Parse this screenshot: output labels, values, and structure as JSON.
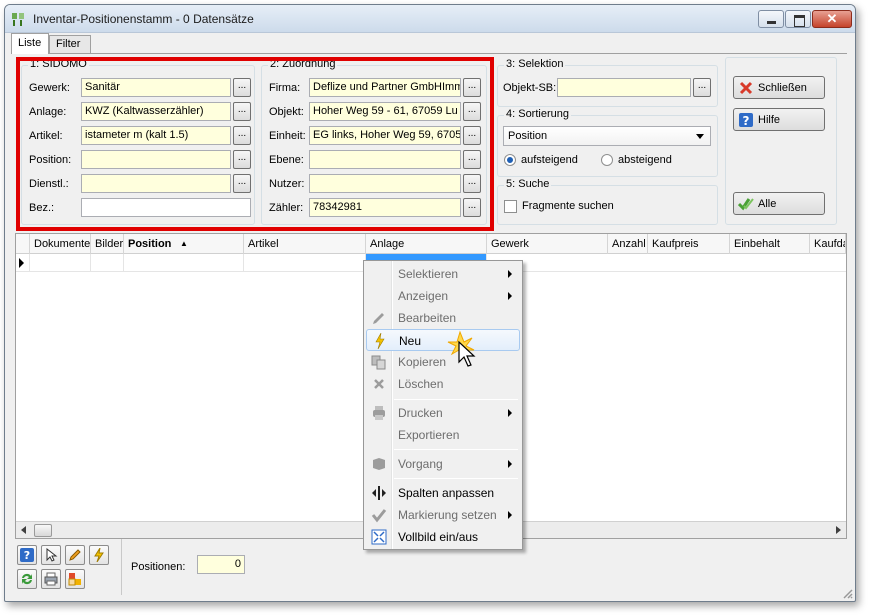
{
  "window": {
    "title": "Inventar-Positionenstamm - 0 Datensätze"
  },
  "tabs": [
    {
      "label": "Liste"
    },
    {
      "label": "Filter"
    }
  ],
  "sidomo": {
    "title": "1: SIDOMO",
    "fields": [
      {
        "label": "Gewerk:",
        "value": "Sanitär"
      },
      {
        "label": "Anlage:",
        "value": "KWZ (Kaltwasserzähler)"
      },
      {
        "label": "Artikel:",
        "value": "istameter m (kalt 1.5)"
      },
      {
        "label": "Position:",
        "value": ""
      },
      {
        "label": "Dienstl.:",
        "value": ""
      },
      {
        "label": "Bez.:",
        "value": ""
      }
    ]
  },
  "zuordnung": {
    "title": "2: Zuordnung",
    "fields": [
      {
        "label": "Firma:",
        "value": "Deflize und Partner GmbHImm"
      },
      {
        "label": "Objekt:",
        "value": "Hoher Weg 59 - 61, 67059 Lu"
      },
      {
        "label": "Einheit:",
        "value": "EG links, Hoher Weg 59, 6705"
      },
      {
        "label": "Ebene:",
        "value": ""
      },
      {
        "label": "Nutzer:",
        "value": ""
      },
      {
        "label": "Zähler:",
        "value": "78342981"
      }
    ]
  },
  "selektion": {
    "title": "3: Selektion",
    "label": "Objekt-SB:",
    "value": ""
  },
  "sortierung": {
    "title": "4: Sortierung",
    "selected": "Position",
    "asc": "aufsteigend",
    "desc": "absteigend"
  },
  "suche": {
    "title": "5: Suche",
    "checkbox": "Fragmente suchen"
  },
  "buttons": {
    "schliessen": "Schließen",
    "hilfe": "Hilfe",
    "alle": "Alle",
    "dots": "..."
  },
  "grid": {
    "columns": [
      "Dokumente",
      "Bilder",
      "Position",
      "Artikel",
      "Anlage",
      "Gewerk",
      "Anzahl",
      "Kaufpreis",
      "Einbehalt",
      "Kaufda"
    ]
  },
  "footer": {
    "positionen_label": "Positionen:",
    "positionen_value": "0"
  },
  "context_menu": [
    {
      "label": "Selektieren",
      "enabled": false,
      "submenu": true
    },
    {
      "label": "Anzeigen",
      "enabled": false,
      "submenu": true
    },
    {
      "label": "Bearbeiten",
      "enabled": false,
      "submenu": false
    },
    {
      "label": "Neu",
      "enabled": true,
      "submenu": false
    },
    {
      "label": "Kopieren",
      "enabled": false,
      "submenu": false
    },
    {
      "label": "Löschen",
      "enabled": false,
      "submenu": false
    },
    {
      "label": "Drucken",
      "enabled": false,
      "submenu": true
    },
    {
      "label": "Exportieren",
      "enabled": false,
      "submenu": false
    },
    {
      "label": "Vorgang",
      "enabled": false,
      "submenu": true
    },
    {
      "label": "Spalten anpassen",
      "enabled": true,
      "submenu": false
    },
    {
      "label": "Markierung setzen",
      "enabled": false,
      "submenu": true
    },
    {
      "label": "Vollbild ein/aus",
      "enabled": true,
      "submenu": false
    }
  ]
}
